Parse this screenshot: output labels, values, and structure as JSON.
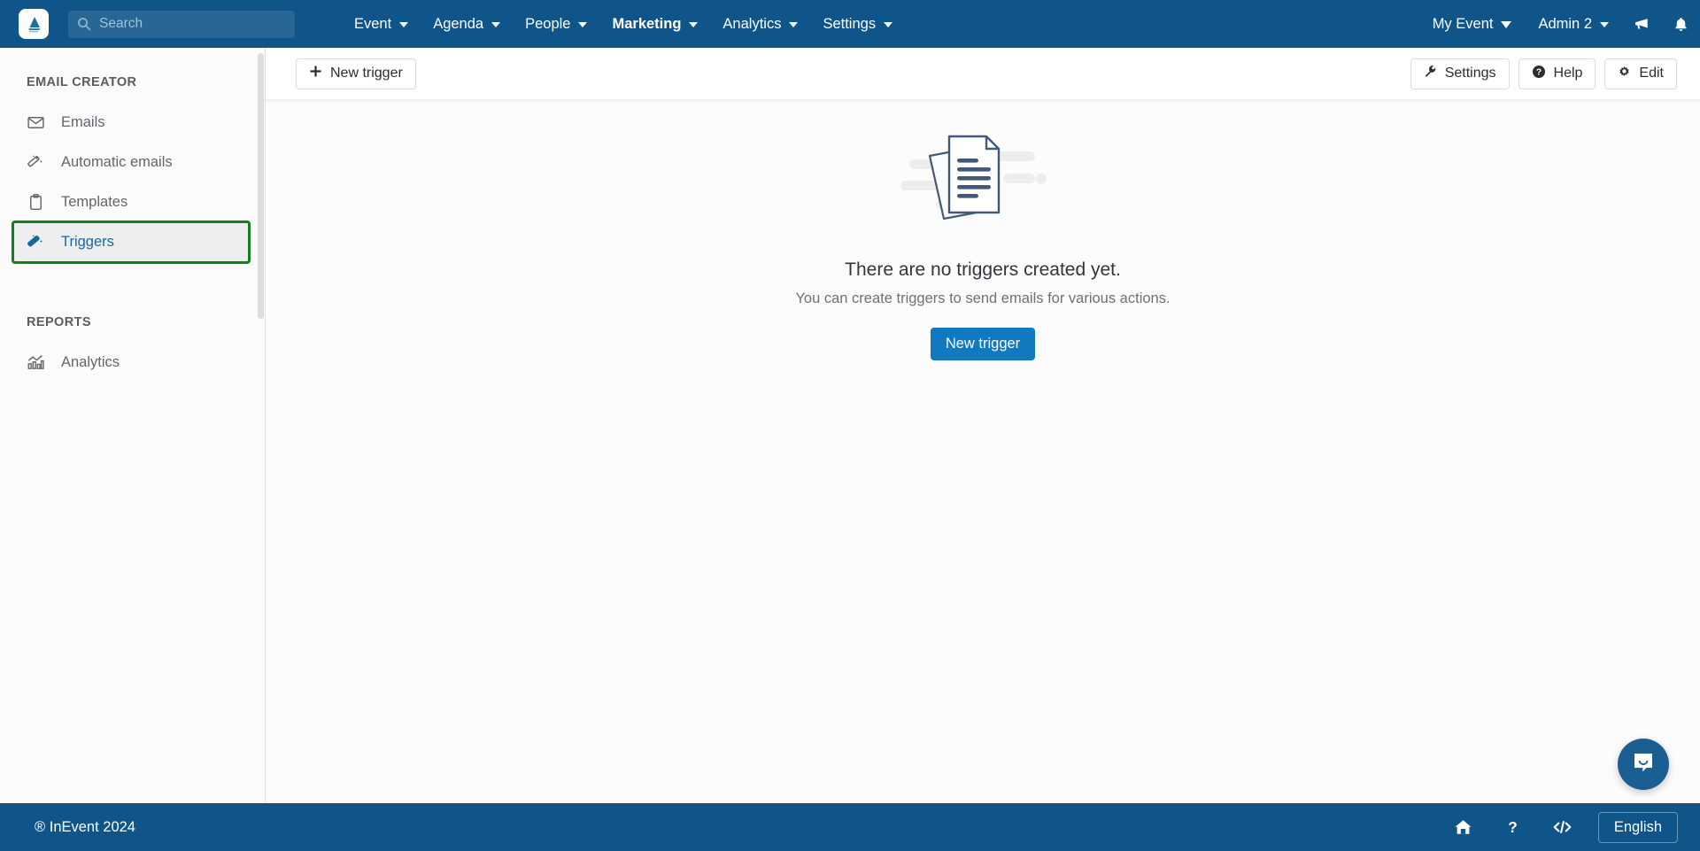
{
  "topnav": {
    "logo_icon": "inevent-logo-icon",
    "search": {
      "placeholder": "Search",
      "value": "",
      "icon": "search-icon"
    },
    "menu": [
      {
        "label": "Event",
        "active": false
      },
      {
        "label": "Agenda",
        "active": false
      },
      {
        "label": "People",
        "active": false
      },
      {
        "label": "Marketing",
        "active": true
      },
      {
        "label": "Analytics",
        "active": false
      },
      {
        "label": "Settings",
        "active": false
      }
    ],
    "event_selector": "My Event",
    "account": "Admin 2",
    "announcements_icon": "megaphone-icon",
    "notifications_icon": "bell-icon",
    "background_color": "#0f5589"
  },
  "sidebar": {
    "sections": [
      {
        "heading": "EMAIL CREATOR",
        "items": [
          {
            "label": "Emails",
            "icon": "envelope-icon",
            "selected": false
          },
          {
            "label": "Automatic emails",
            "icon": "magic-wand-icon",
            "selected": false
          },
          {
            "label": "Templates",
            "icon": "clipboard-icon",
            "selected": false
          },
          {
            "label": "Triggers",
            "icon": "magic-wand-icon",
            "selected": true
          }
        ]
      },
      {
        "heading": "REPORTS",
        "items": [
          {
            "label": "Analytics",
            "icon": "bar-chart-icon",
            "selected": false
          }
        ]
      }
    ],
    "highlight_color": "#12801f",
    "selected_text_color": "#16699f"
  },
  "toolbar": {
    "new_trigger_label": "New trigger",
    "new_trigger_icon": "plus-icon",
    "settings_label": "Settings",
    "settings_icon": "wrench-icon",
    "help_label": "Help",
    "help_icon": "question-circle-icon",
    "edit_label": "Edit",
    "edit_icon": "gear-icon"
  },
  "main": {
    "empty_state": {
      "illustration_icon": "documents-illustration-icon",
      "title": "There are no triggers created yet.",
      "subtitle": "You can create triggers to send emails for various actions.",
      "cta_label": "New trigger",
      "cta_color": "#1179bf"
    }
  },
  "chat": {
    "icon": "chat-bubble-icon",
    "color": "#1b5f92"
  },
  "footer": {
    "copyright": "® InEvent 2024",
    "home_icon": "home-icon",
    "help_icon": "question-mark-icon",
    "developer_icon": "code-icon",
    "language_label": "English",
    "background_color": "#0f5589"
  }
}
